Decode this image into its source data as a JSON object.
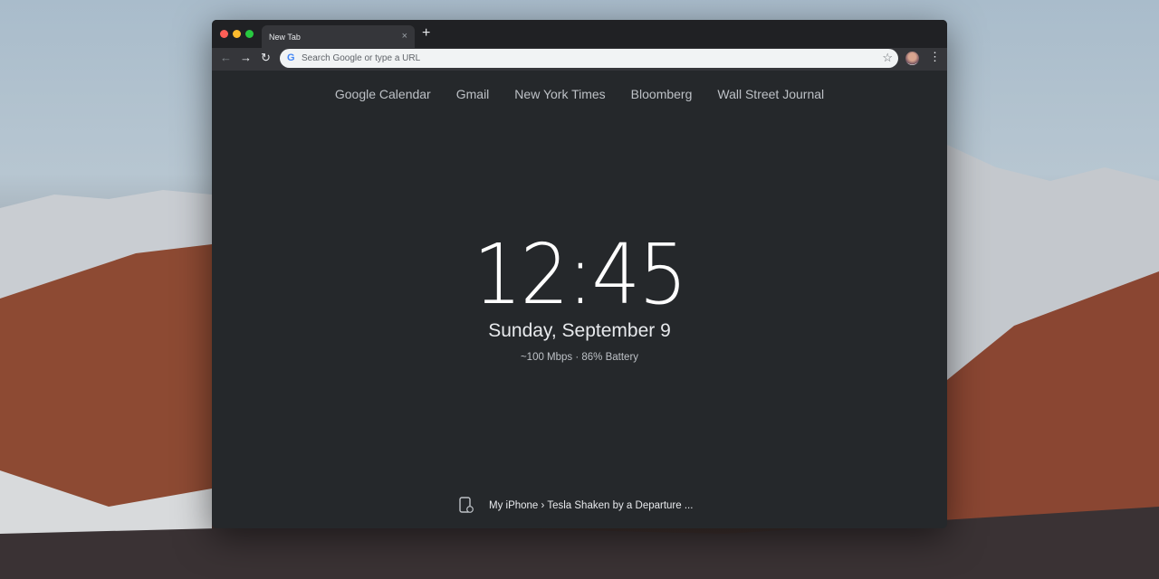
{
  "tab": {
    "title": "New Tab",
    "close": "×",
    "new_tab": "+"
  },
  "toolbar": {
    "back": "←",
    "forward": "→",
    "reload": "↻",
    "placeholder": "Search Google or type a URL",
    "google_g": "G",
    "star": "☆",
    "menu": "⋮"
  },
  "shortcuts": [
    "Google Calendar",
    "Gmail",
    "New York Times",
    "Bloomberg",
    "Wall Street Journal"
  ],
  "clock": {
    "time": "12:45",
    "date": "Sunday, September 9",
    "status": "~100 Mbps · 86% Battery"
  },
  "recent": {
    "text": "My iPhone › Tesla Shaken by a Departure ..."
  },
  "colors": {
    "close": "#fe5f57",
    "minimize": "#febc2e",
    "zoom": "#28c840"
  }
}
